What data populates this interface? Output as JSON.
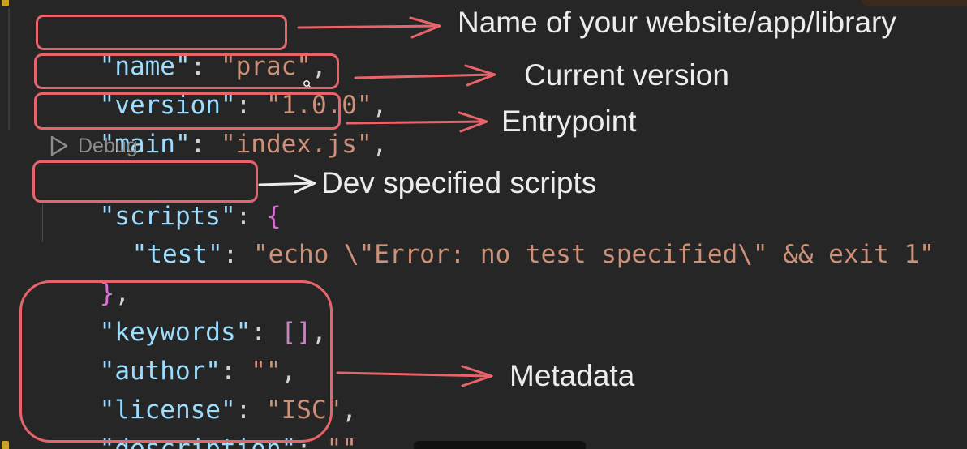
{
  "code": {
    "lines": [
      {
        "key": "\"name\"",
        "sep": ": ",
        "value": "\"prac\"",
        "tail": ","
      },
      {
        "key": "\"version\"",
        "sep": ": ",
        "value": "\"1.0.0\"",
        "tail": ","
      },
      {
        "key": "\"main\"",
        "sep": ": ",
        "value": "\"index.js\"",
        "tail": ","
      },
      {
        "key": "\"scripts\"",
        "sep": ": ",
        "value": "{",
        "tail": ""
      },
      {
        "key": "\"test\"",
        "sep": ": ",
        "value": "\"echo \\\"Error: no test specified\\\" && exit 1\"",
        "tail": ""
      },
      {
        "key": "",
        "sep": "",
        "value": "}",
        "tail": ","
      },
      {
        "key": "\"keywords\"",
        "sep": ": ",
        "value": "[]",
        "tail": ","
      },
      {
        "key": "\"author\"",
        "sep": ": ",
        "value": "\"\"",
        "tail": ","
      },
      {
        "key": "\"license\"",
        "sep": ": ",
        "value": "\"ISC\"",
        "tail": ","
      },
      {
        "key": "\"description\"",
        "sep": ": ",
        "value": "\"\"",
        "tail": ""
      }
    ]
  },
  "codelens": {
    "label": "Debug",
    "icon": "play-icon"
  },
  "annotations": {
    "name": "Name of your website/app/library",
    "version": "Current version",
    "main": "Entrypoint",
    "scripts": "Dev specified scripts",
    "metadata": "Metadata"
  },
  "colors": {
    "background": "#262626",
    "json_key": "#9cdcfe",
    "json_string": "#ce9178",
    "bracket": "#da70d6",
    "annotation": "#e8646a",
    "annotation_text": "#ececec"
  }
}
